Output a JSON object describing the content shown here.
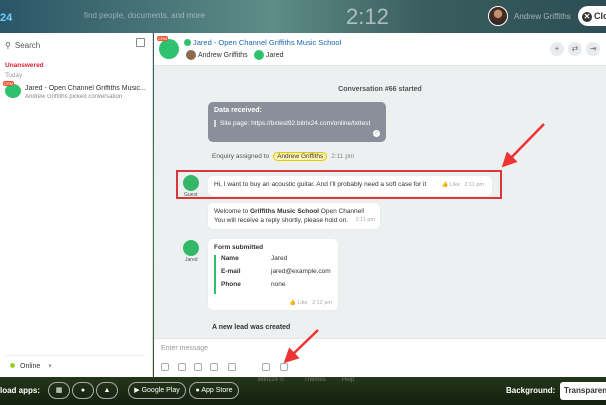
{
  "topbar": {
    "logo": "24",
    "search_placeholder": "find people, documents, and more",
    "clock": "2:12",
    "user_name": "Andrew Griffiths",
    "close_label": "Clo"
  },
  "sidebar": {
    "search_label": "Search",
    "section_unanswered": "Unanswered",
    "section_today": "Today",
    "chat_item": {
      "badge": "CRM",
      "title": "Jared - Open Channel Griffiths Music...",
      "subtitle": "Andrew Griffiths picked conversation"
    },
    "status": "Online"
  },
  "chat": {
    "badge": "CRM",
    "title": "Jared - Open Channel Griffiths Music School",
    "participants": [
      "Andrew Griffiths",
      "Jared"
    ],
    "header_buttons": [
      "+",
      "⇄",
      "⇥"
    ],
    "conversation_started": "Conversation #66 started",
    "data_received": {
      "heading": "Data received:",
      "site_page": "Site page: https://bxtest92.bitrix24.com/online/txttest"
    },
    "enquiry": {
      "prefix": "Enquiry assigned to",
      "assignee": "Andrew Griffiths",
      "time": "2:11 pm"
    },
    "guest_label": "Guest",
    "guest_message": {
      "text": "Hi, I want to buy an acoustic guitar. And I'll probably need a soft case for it",
      "like": "Like",
      "time": "2:11 pm"
    },
    "welcome": {
      "line1_prefix": "Welcome to ",
      "line1_brand": "Griffiths Music School",
      "line1_suffix": " Open Channel!",
      "line2": "You will receive a reply shortly, please hold on.",
      "time": "2:11 pm"
    },
    "jared_label": "Jared",
    "form": {
      "heading": "Form submitted",
      "fields": [
        {
          "key": "Name",
          "value": "Jared"
        },
        {
          "key": "E-mail",
          "value": "jared@example.com"
        },
        {
          "key": "Phone",
          "value": "none"
        }
      ],
      "like": "Like",
      "time": "2:12 pm"
    },
    "new_lead": "A new lead was created",
    "input_placeholder": "Enter message"
  },
  "bottombar": {
    "download_label": "load apps:",
    "google_play": "Google Play",
    "app_store": "App Store",
    "faint_items": [
      "Bitrix24 ©",
      "Themes",
      "Help"
    ],
    "background_label": "Background:",
    "background_value": "Transparent"
  },
  "colors": {
    "accent_green": "#2fc26e",
    "annotation_red": "#d9383a",
    "link_blue": "#2067b0"
  }
}
